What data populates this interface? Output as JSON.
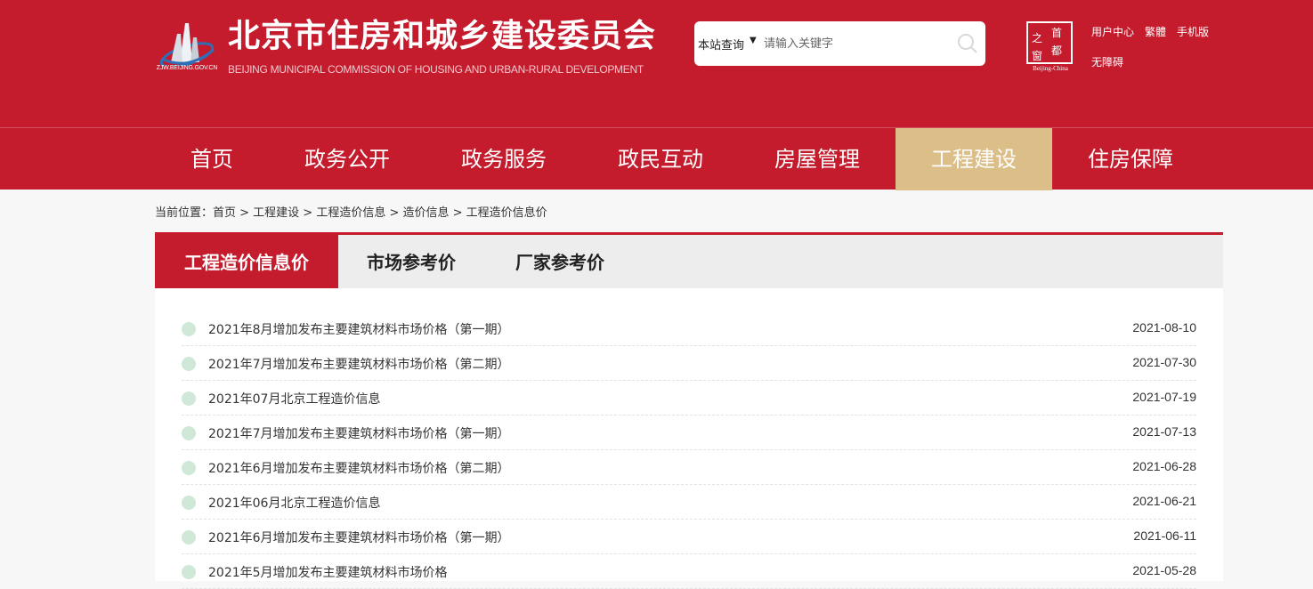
{
  "header": {
    "logo_url_text": "ZJW.BEIJING.GOV.CN",
    "title": "北京市住房和城乡建设委员会",
    "subtitle": "BEIJING MUNICIPAL COMMISSION OF HOUSING AND URBAN-RURAL DEVELOPMENT",
    "seal": {
      "chars": [
        "之",
        "首",
        "窗",
        "都"
      ],
      "caption": "Beijing-China"
    },
    "links": [
      "用户中心",
      "繁體",
      "手机版",
      "无障碍"
    ]
  },
  "search": {
    "scope": "本站查询",
    "placeholder": "请输入关键字",
    "icon": "search-icon"
  },
  "nav": {
    "items": [
      "首页",
      "政务公开",
      "政务服务",
      "政民互动",
      "房屋管理",
      "工程建设",
      "住房保障"
    ],
    "active": "工程建设"
  },
  "breadcrumb": "当前位置：首页 > 工程建设 > 工程造价信息 > 造价信息 > 工程造价信息价",
  "tabs": {
    "items": [
      "工程造价信息价",
      "市场参考价",
      "厂家参考价"
    ],
    "active": "工程造价信息价"
  },
  "list": [
    {
      "title": "2021年8月增加发布主要建筑材料市场价格（第一期）",
      "date": "2021-08-10"
    },
    {
      "title": "2021年7月增加发布主要建筑材料市场价格（第二期）",
      "date": "2021-07-30"
    },
    {
      "title": "2021年07月北京工程造价信息",
      "date": "2021-07-19"
    },
    {
      "title": "2021年7月增加发布主要建筑材料市场价格（第一期）",
      "date": "2021-07-13"
    },
    {
      "title": "2021年6月增加发布主要建筑材料市场价格（第二期）",
      "date": "2021-06-28"
    },
    {
      "title": "2021年06月北京工程造价信息",
      "date": "2021-06-21"
    },
    {
      "title": "2021年6月增加发布主要建筑材料市场价格（第一期）",
      "date": "2021-06-11"
    },
    {
      "title": "2021年5月增加发布主要建筑材料市场价格",
      "date": "2021-05-28"
    }
  ],
  "colors": {
    "brand_red": "#c41b2d",
    "nav_active": "#dcbf88",
    "list_dot": "#cfe8d8"
  }
}
